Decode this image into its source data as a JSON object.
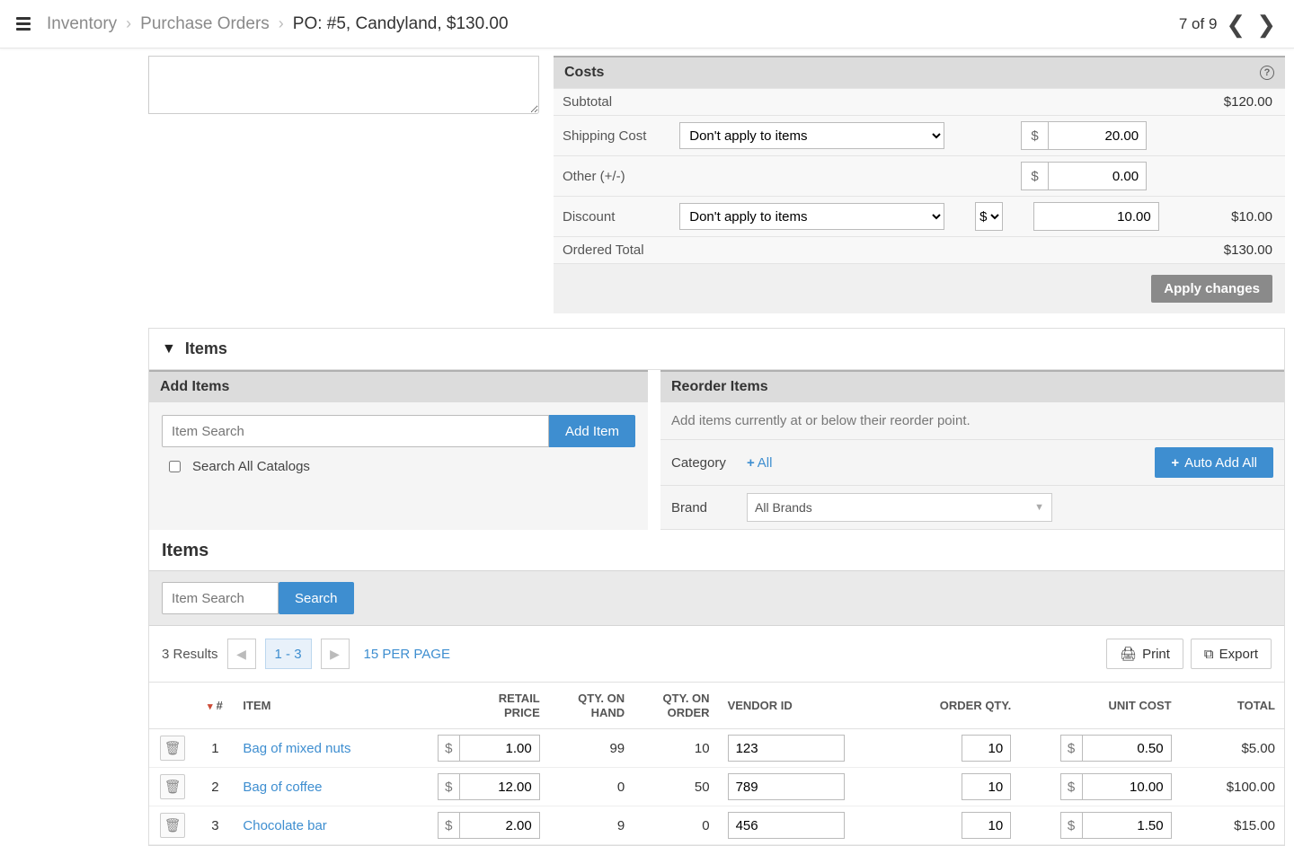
{
  "breadcrumb": {
    "root": "Inventory",
    "mid": "Purchase Orders",
    "current": "PO:  #5, Candyland, $130.00"
  },
  "pager": {
    "text": "7 of 9"
  },
  "costs": {
    "header": "Costs",
    "rows": {
      "subtotal_label": "Subtotal",
      "subtotal_value": "$120.00",
      "shipping_label": "Shipping Cost",
      "shipping_option": "Don't apply to items",
      "shipping_amount": "20.00",
      "other_label": "Other (+/-)",
      "other_amount": "0.00",
      "discount_label": "Discount",
      "discount_option": "Don't apply to items",
      "discount_type": "$",
      "discount_amount": "10.00",
      "discount_value": "$10.00",
      "ordered_total_label": "Ordered Total",
      "ordered_total_value": "$130.00"
    },
    "apply_btn": "Apply changes",
    "currency": "$"
  },
  "items_section": {
    "title": "Items",
    "add_items": {
      "header": "Add Items",
      "placeholder": "Item Search",
      "button": "Add Item",
      "checkbox_label": "Search All Catalogs"
    },
    "reorder_items": {
      "header": "Reorder Items",
      "hint": "Add items currently at or below their reorder point.",
      "category_label": "Category",
      "category_all": "All",
      "brand_label": "Brand",
      "brand_value": "All Brands",
      "auto_add": "Auto Add All"
    },
    "items_sub_header": "Items",
    "search_placeholder": "Item Search",
    "search_button": "Search",
    "results_text": "3 Results",
    "page_range": "1 - 3",
    "per_page": "15 PER PAGE",
    "print": "Print",
    "export": "Export",
    "columns": {
      "num": "#",
      "item": "ITEM",
      "retail": "RETAIL PRICE",
      "qty_hand": "QTY. ON HAND",
      "qty_order": "QTY. ON ORDER",
      "vendor": "VENDOR ID",
      "order_qty": "ORDER QTY.",
      "unit_cost": "UNIT COST",
      "total": "TOTAL"
    },
    "rows": [
      {
        "n": "1",
        "name": "Bag of mixed nuts",
        "retail": "1.00",
        "hand": "99",
        "on_order": "10",
        "vendor": "123",
        "order_qty": "10",
        "unit_cost": "0.50",
        "total": "$5.00"
      },
      {
        "n": "2",
        "name": "Bag of coffee",
        "retail": "12.00",
        "hand": "0",
        "on_order": "50",
        "vendor": "789",
        "order_qty": "10",
        "unit_cost": "10.00",
        "total": "$100.00"
      },
      {
        "n": "3",
        "name": "Chocolate bar",
        "retail": "2.00",
        "hand": "9",
        "on_order": "0",
        "vendor": "456",
        "order_qty": "10",
        "unit_cost": "1.50",
        "total": "$15.00"
      }
    ]
  }
}
